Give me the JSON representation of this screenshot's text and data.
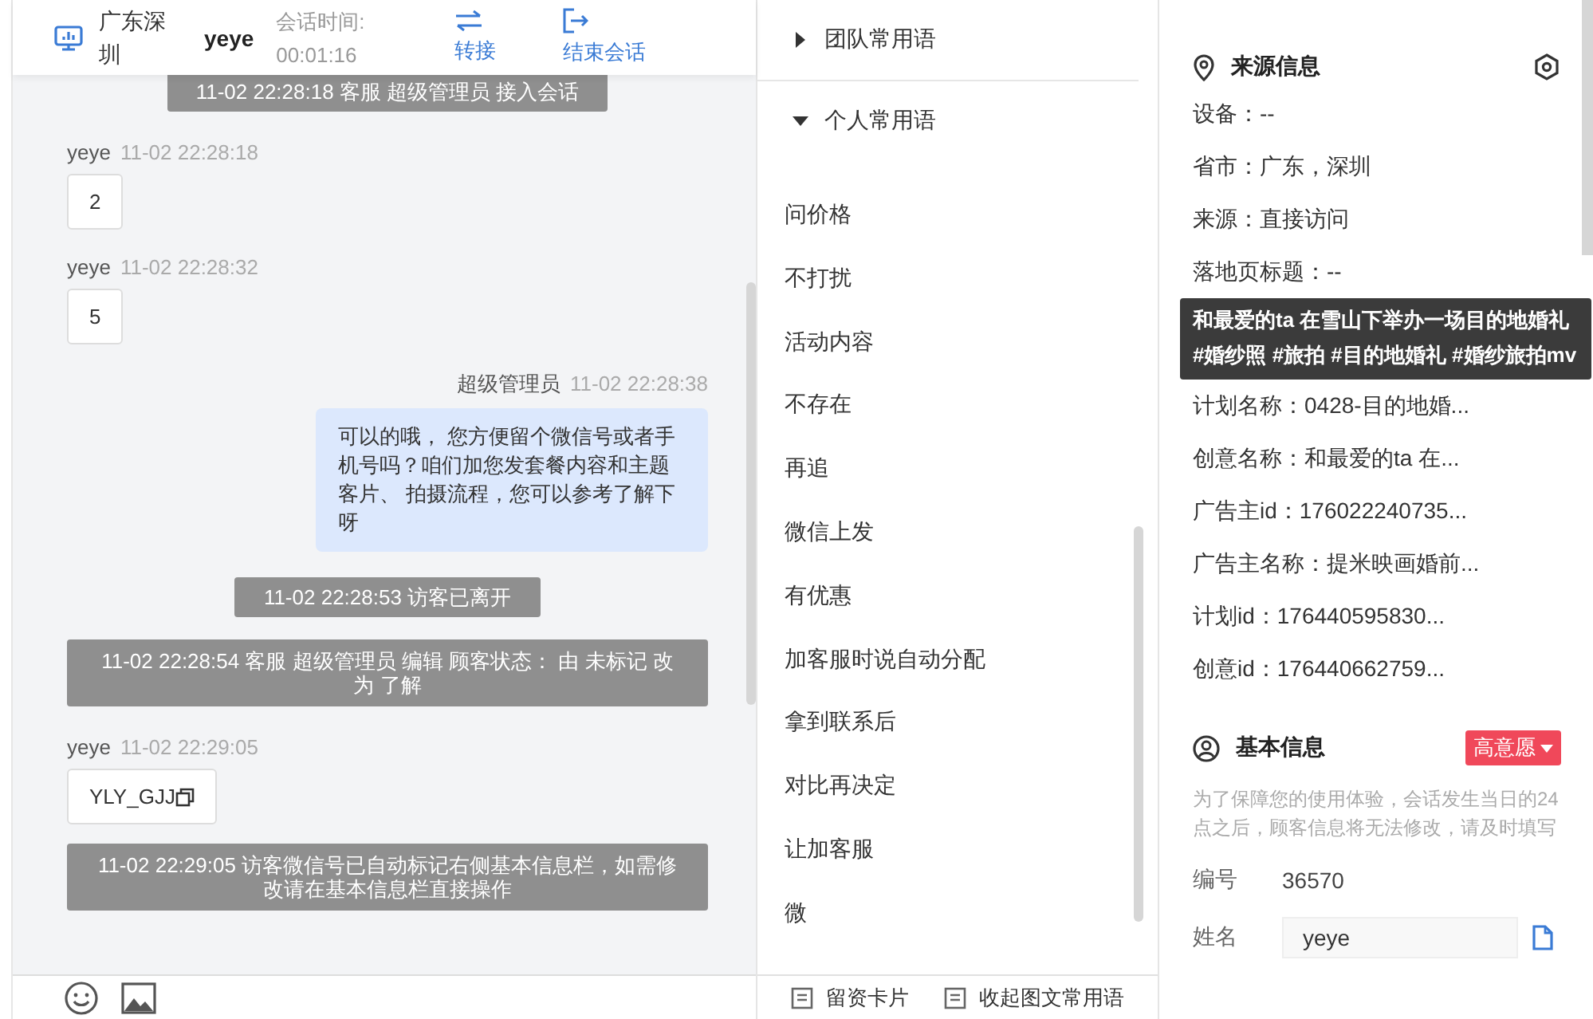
{
  "chat_header": {
    "location": "广东深圳",
    "visitor": "yeye",
    "duration_label": "会话时间:",
    "duration": "00:01:16",
    "actions": [
      {
        "label": "转接",
        "kind": "transfer"
      },
      {
        "label": "结束会话",
        "kind": "end"
      }
    ]
  },
  "messages": [
    {
      "kind": "system",
      "text": "11-02 22:28:18 客服 超级管理员 接入会话"
    },
    {
      "kind": "visitor",
      "sender": "yeye",
      "time": "11-02 22:28:18",
      "text": "2",
      "copyable": false
    },
    {
      "kind": "visitor",
      "sender": "yeye",
      "time": "11-02 22:28:32",
      "text": "5",
      "copyable": false
    },
    {
      "kind": "agent",
      "sender": "超级管理员",
      "time": "11-02 22:28:38",
      "text": "可以的哦， 您方便留个微信号或者手机号吗？咱们加您发套餐内容和主题客片、 拍摄流程，您可以参考了解下呀"
    },
    {
      "kind": "system",
      "text": "11-02 22:28:53 访客已离开"
    },
    {
      "kind": "system",
      "text": "11-02 22:28:54 客服 超级管理员 编辑 顾客状态： 由 未标记 改为 了解"
    },
    {
      "kind": "visitor",
      "sender": "yeye",
      "time": "11-02 22:29:05",
      "text": "YLY_GJJ",
      "copyable": true
    },
    {
      "kind": "system",
      "text": "11-02 22:29:05 访客微信号已自动标记右侧基本信息栏，如需修改请在基本信息栏直接操作"
    }
  ],
  "phrases": {
    "groups": [
      {
        "label": "团队常用语",
        "expanded": false
      },
      {
        "label": "个人常用语",
        "expanded": true,
        "items": [
          "问价格",
          "不打扰",
          "活动内容",
          "不存在",
          "再追",
          "微信上发",
          "有优惠",
          "加客服时说自动分配",
          "拿到联系后",
          "对比再决定",
          "让加客服",
          "微"
        ]
      }
    ],
    "footer_actions": [
      "留资卡片",
      "收起图文常用语"
    ]
  },
  "source_info": {
    "title": "来源信息",
    "fields": [
      "设备：--",
      "省市：广东，深圳",
      "来源：直接访问",
      "落地页标题：--",
      "计划名称：0428-目的地婚...",
      "创意名称：和最爱的ta 在...",
      "广告主id：176022240735...",
      "广告主名称：提米映画婚前...",
      "计划id：176440595830...",
      "创意id：176440662759..."
    ],
    "tooltip": "和最爱的ta 在雪山下举办一场目的地婚礼#婚纱照 #旅拍 #目的地婚礼 #婚纱旅拍mv"
  },
  "basic_info": {
    "title": "基本信息",
    "intent_tag": "高意愿",
    "notice": "为了保障您的使用体验，会话发生当日的24点之后，顾客信息将无法修改，请及时填写",
    "fields": [
      {
        "kind": "text",
        "label": "编号",
        "value": "36570"
      },
      {
        "kind": "input",
        "label": "姓名",
        "value": "yeye"
      }
    ]
  }
}
